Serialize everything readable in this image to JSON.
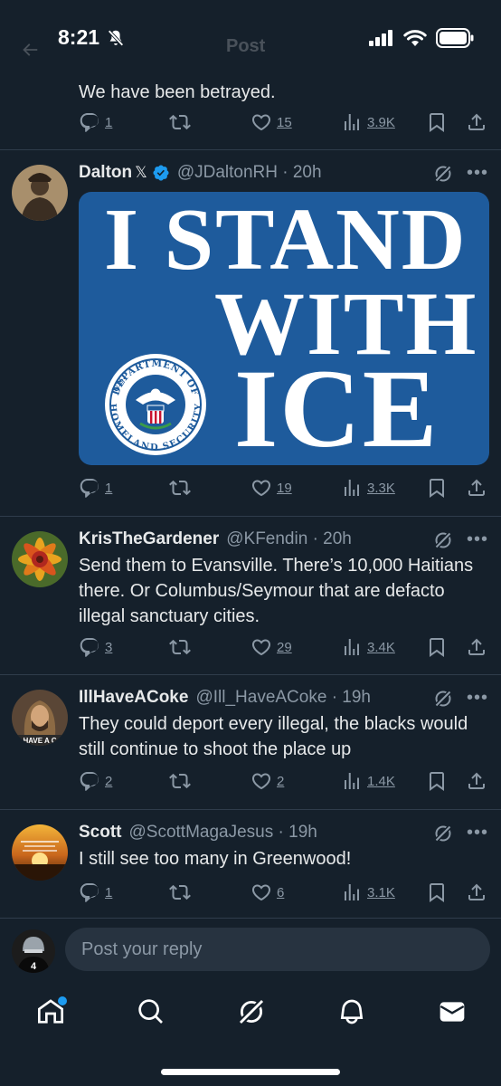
{
  "status_bar": {
    "time": "8:21"
  },
  "header": {
    "title": "Post"
  },
  "colors": {
    "background": "#15202b",
    "accent": "#1d9bf0",
    "text": "#e7e9ea",
    "muted": "#8b98a5",
    "ice_blue": "#1e5b9c"
  },
  "top_tweet": {
    "text": "We have been betrayed.",
    "replies": "1",
    "likes": "15",
    "views": "3.9K"
  },
  "tweets": [
    {
      "name": "Dalton",
      "handle_time": "@JDaltonRH · 20h",
      "verified": true,
      "x_badge": "𝕏",
      "image": {
        "line1": "I STAND",
        "line2": "WITH",
        "line3": "ICE",
        "seal_top": "DEPARTMENT OF",
        "seal_left": "U.S.",
        "seal_bottom": "HOMELAND SECURITY"
      },
      "replies": "1",
      "likes": "19",
      "views": "3.3K"
    },
    {
      "name": "KrisTheGardener",
      "handle_time": "@KFendin · 20h",
      "text": "Send them to Evansville. There’s 10,000 Haitians there. Or Columbus/Seymour that are defacto illegal sanctuary cities.",
      "replies": "3",
      "likes": "29",
      "views": "3.4K"
    },
    {
      "name": "IllHaveACoke",
      "handle_time": "@Ill_HaveACoke · 19h",
      "text": "They could deport every illegal, the blacks would still continue to shoot the place up",
      "avatar_text": "HAVE A C",
      "replies": "2",
      "likes": "2",
      "views": "1.4K"
    },
    {
      "name": "Scott",
      "handle_time": "@ScottMagaJesus · 19h",
      "text": "I still see too many in Greenwood!",
      "replies": "1",
      "likes": "6",
      "views": "3.1K"
    }
  ],
  "reply": {
    "placeholder": "Post your reply"
  },
  "tabs": [
    "home-icon",
    "search-icon",
    "grok-icon",
    "notifications-icon",
    "messages-icon"
  ]
}
